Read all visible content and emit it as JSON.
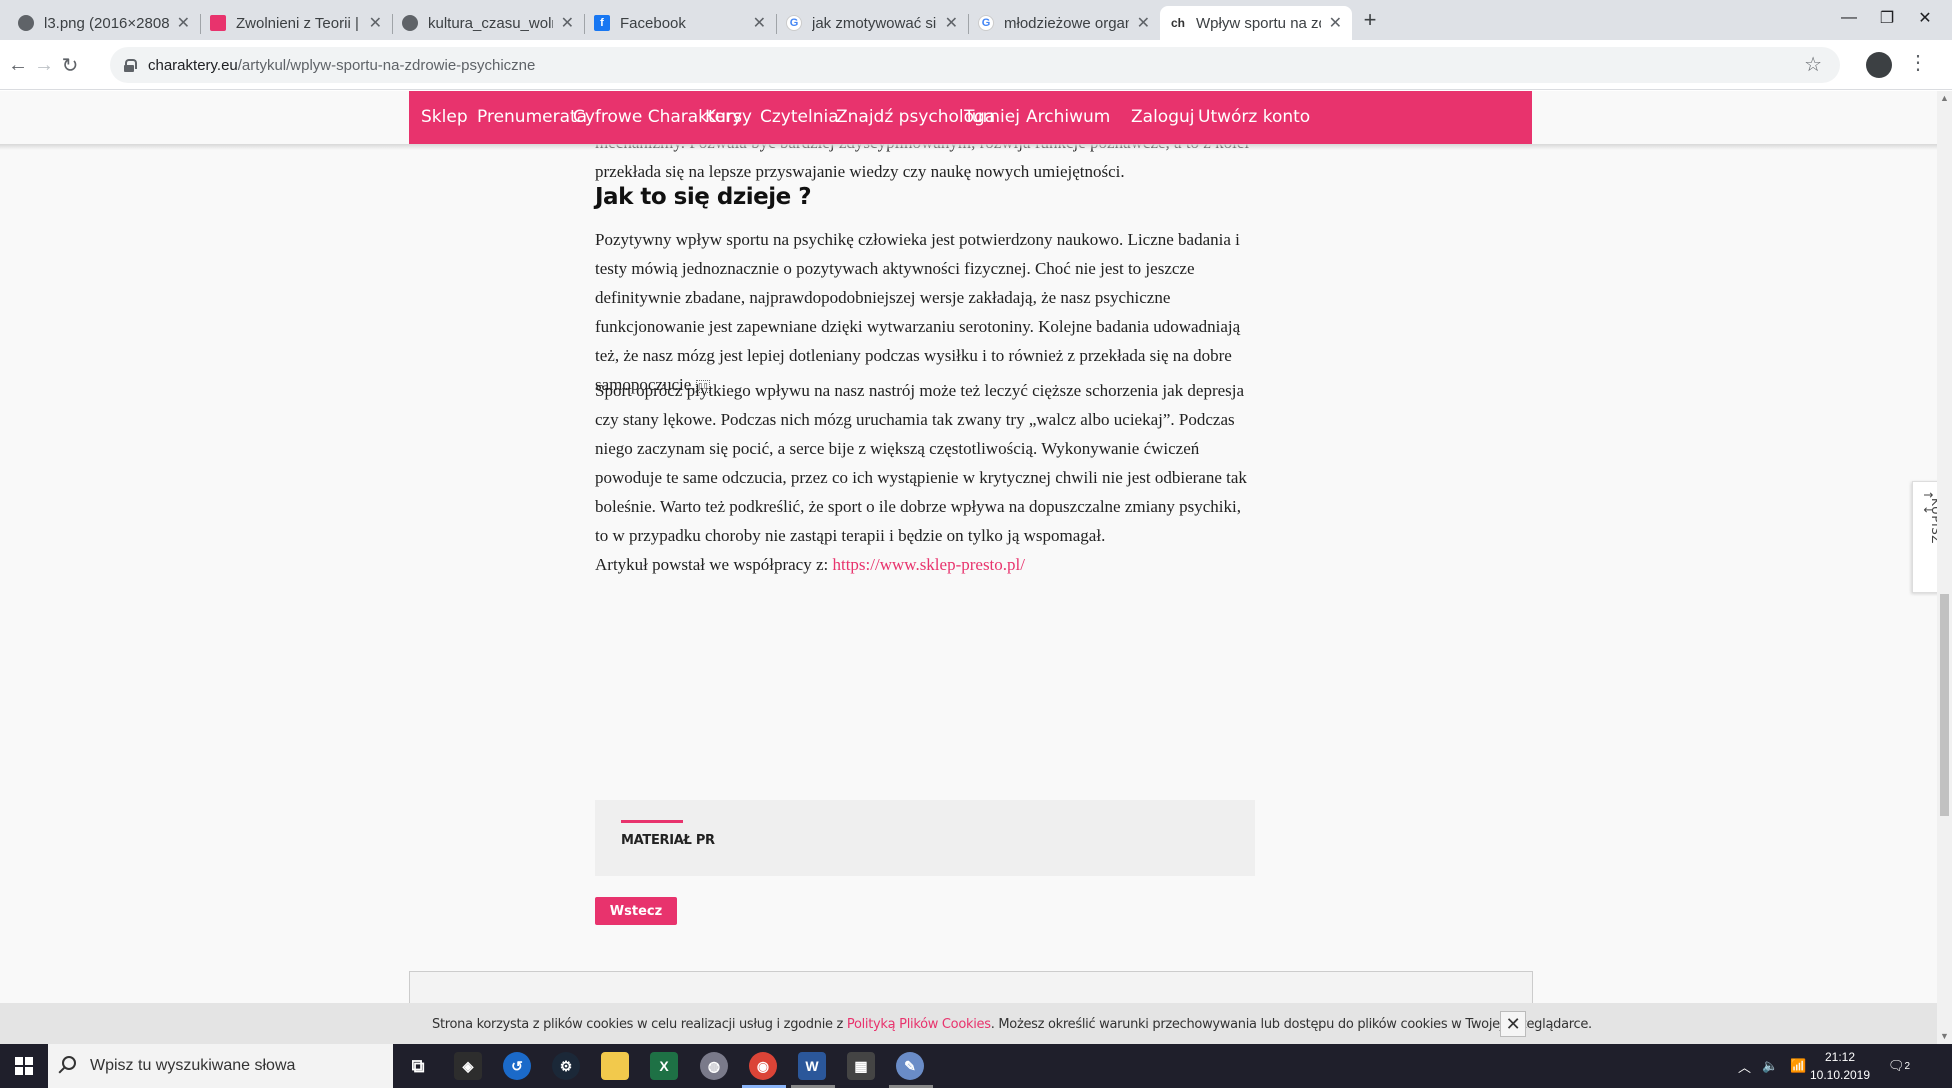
{
  "browser": {
    "tabs": [
      {
        "title": "l3.png (2016×2808)",
        "favicon": "globe-icon",
        "active": false
      },
      {
        "title": "Zwolnieni z Teorii |",
        "favicon": "zzt-icon",
        "active": false
      },
      {
        "title": "kultura_czasu_wolnego_we_wspc",
        "favicon": "globe-icon",
        "active": false
      },
      {
        "title": "Facebook",
        "favicon": "facebook-icon",
        "active": false
      },
      {
        "title": "jak zmotywować się do sportu - S",
        "favicon": "google-icon",
        "active": false
      },
      {
        "title": "młodzieżowe organizacje sporto",
        "favicon": "google-icon",
        "active": false
      },
      {
        "title": "Wpływ sportu na zdrowie psychic",
        "favicon": "charaktery-icon",
        "active": true
      }
    ],
    "new_tab": "+",
    "url_host": "charaktery.eu",
    "url_path": "/artykul/wplyw-sportu-na-zdrowie-psychiczne"
  },
  "site_nav": {
    "items": [
      "Sklep",
      "Prenumerata",
      "Cyfrowe Charaktery",
      "Kursy",
      "Czytelnia",
      "Znajdź psychologa",
      "Turniej",
      "Archiwum"
    ],
    "login": "Zaloguj",
    "register": "Utwórz konto",
    "accent_color": "#e8336d"
  },
  "article": {
    "p1": "Oprócz bezpośredniego zwiększenia dobrego samopoczucia sport buduje w człowieku pewne mechanizmy. Pozwala być bardziej zdyscyplinowanym, rozwija funkcje poznawcze, a to z kolei przekłada się na lepsze przyswajanie wiedzy czy naukę nowych umiejętności.",
    "heading": "Jak to się dzieje ?",
    "p2": "Pozytywny wpływ sportu na psychikę człowieka jest potwierdzony naukowo. Liczne badania i testy mówią jednoznacznie o pozytywach aktywności fizycznej. Choć nie jest to jeszcze definitywnie zbadane, najprawdopodobniejszej wersje zakładają, że nasz psychiczne funkcjonowanie jest zapewniane dzięki wytwarzaniu serotoniny. Kolejne badania udowadniają też, że nasz mózg jest lepiej dotleniany podczas wysiłku i to również z przekłada się na dobre samopoczucie.",
    "p3": "Sport oprócz płytkiego wpływu na nasz nastrój może też leczyć cięższe schorzenia jak depresja czy stany lękowe. Podczas nich mózg uruchamia tak zwany try „walcz albo uciekaj”. Podczas niego zaczynam się pocić, a serce bije z większą częstotliwością. Wykonywanie ćwiczeń powoduje te same odczucia, przez co ich wystąpienie w krytycznej chwili nie jest odbierane tak boleśnie. Warto też podkreślić, że sport o ile dobrze wpływa na dopuszczalne zmiany psychiki, to w przypadku choroby nie zastąpi terapii i będzie on tylko ją wspomagał.",
    "coop_prefix": "Artykuł powstał we współpracy z: ",
    "coop_link": "https://www.sklep-presto.pl/"
  },
  "pr_label": "MATERIAŁ PR",
  "back_button": "Wstecz",
  "side_tab": "TU KUPISZ",
  "cookie": {
    "text_before": "Strona korzysta z plików cookies w celu realizacji usług i zgodnie z ",
    "link": "Polityką Plików Cookies",
    "text_after": ". Możesz określić warunki przechowywania lub dostępu do plików cookies w Twojej przeglądarce."
  },
  "taskbar": {
    "search_placeholder": "Wpisz tu wyszukiwane słowa",
    "time": "21:12",
    "date": "10.10.2019",
    "notification_count": "2"
  }
}
